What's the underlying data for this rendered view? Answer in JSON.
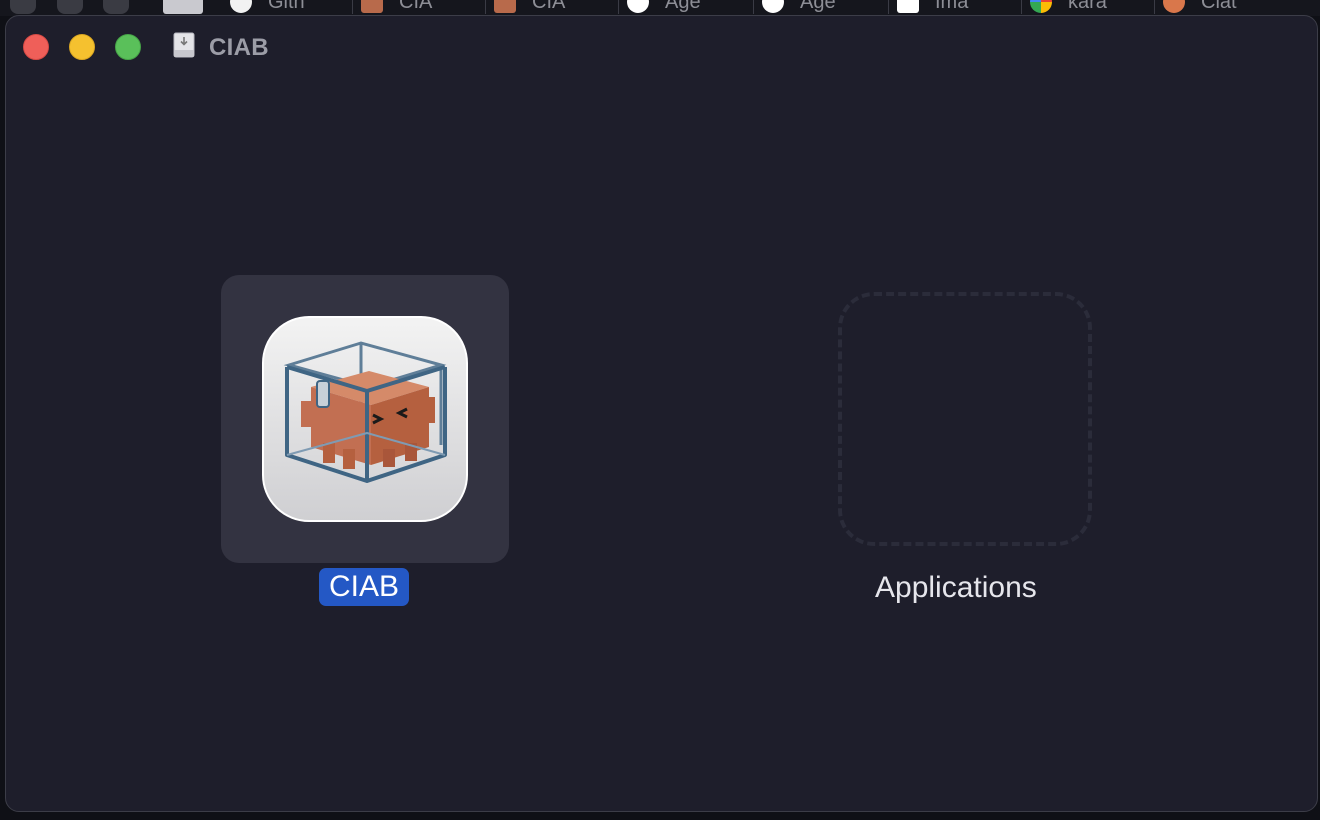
{
  "browser_tabs": [
    {
      "label": "Gith"
    },
    {
      "label": "CIA"
    },
    {
      "label": "CIA"
    },
    {
      "label": "Age"
    },
    {
      "label": "Age"
    },
    {
      "label": "Ima"
    },
    {
      "label": "kara"
    },
    {
      "label": "Clat"
    }
  ],
  "window": {
    "title": "CIAB"
  },
  "items": {
    "app": {
      "label": "CIAB",
      "icon": "ciab-app-icon",
      "selected": true
    },
    "alias": {
      "label": "Applications",
      "icon": "applications-folder-placeholder"
    }
  },
  "colors": {
    "window_bg": "#1e1e2b",
    "selection": "#2458c5",
    "selected_tile": "#333341"
  }
}
